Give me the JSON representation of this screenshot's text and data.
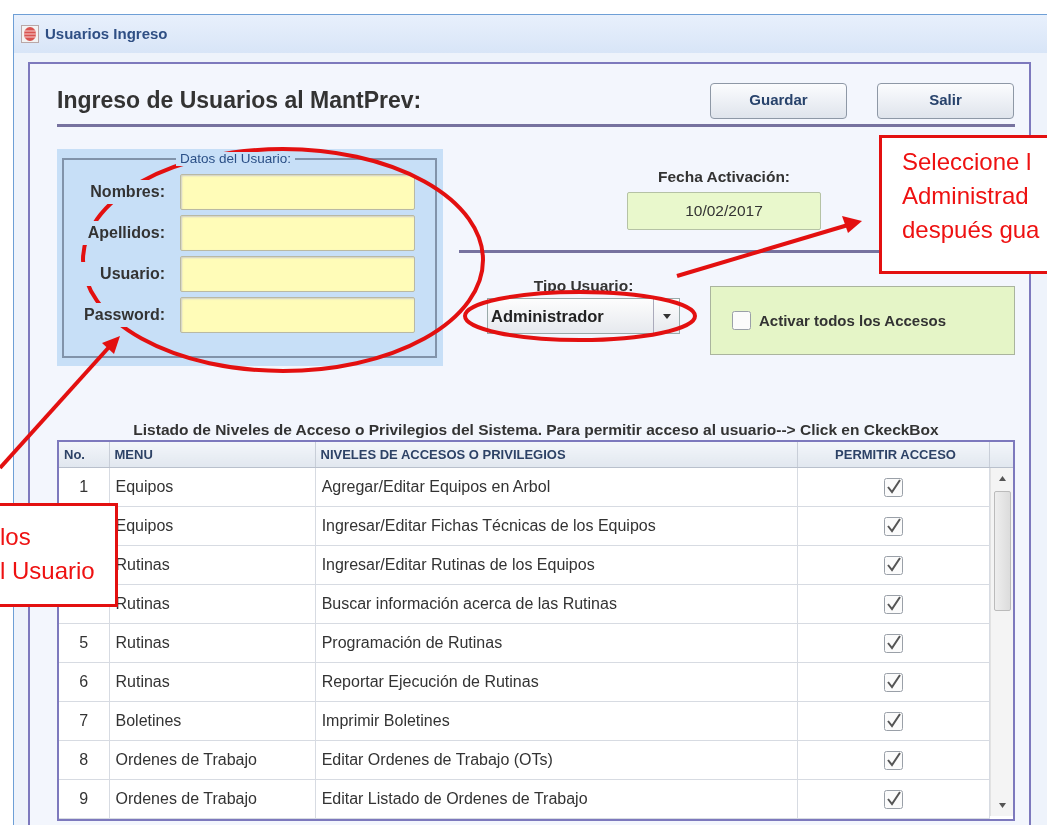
{
  "window": {
    "title": "Usuarios Ingreso"
  },
  "header": {
    "title": "Ingreso de Usuarios al MantPrev:",
    "buttons": [
      "Guardar",
      "Salir"
    ]
  },
  "user_group": {
    "legend": "Datos del Usuario:",
    "fields": [
      {
        "label": "Nombres:"
      },
      {
        "label": "Apellidos:"
      },
      {
        "label": "Usuario:"
      },
      {
        "label": "Password:"
      }
    ]
  },
  "activation": {
    "label": "Fecha Activación:",
    "value": "10/02/2017"
  },
  "user_type": {
    "label": "Tipo Usuario:",
    "value": "Administrador"
  },
  "activate_all": {
    "label": "Activar todos los Accesos",
    "checked": false
  },
  "table": {
    "caption": "Listado de Niveles de Acceso o Privilegios del Sistema. Para permitir acceso al usuario--> Click en CkeckBox",
    "columns": [
      "No.",
      "MENU",
      "NIVELES DE ACCESOS O PRIVILEGIOS",
      "PERMITIR ACCESO"
    ],
    "rows": [
      {
        "no": "1",
        "menu": "Equipos",
        "privilege": "Agregar/Editar Equipos en Arbol",
        "allowed": true
      },
      {
        "menu": "Equipos",
        "privilege": "Ingresar/Editar Fichas Técnicas de los Equipos",
        "allowed": true
      },
      {
        "menu": "Rutinas",
        "privilege": "Ingresar/Editar Rutinas de los Equipos",
        "allowed": true
      },
      {
        "menu": "Rutinas",
        "privilege": "Buscar información acerca de las Rutinas",
        "allowed": true
      },
      {
        "no": "5",
        "menu": "Rutinas",
        "privilege": "Programación de Rutinas",
        "allowed": true
      },
      {
        "no": "6",
        "menu": "Rutinas",
        "privilege": "Reportar Ejecución de Rutinas",
        "allowed": true
      },
      {
        "no": "7",
        "menu": "Boletines",
        "privilege": "Imprimir Boletines",
        "allowed": true
      },
      {
        "no": "8",
        "menu": "Ordenes de Trabajo",
        "privilege": "Editar Ordenes de Trabajo (OTs)",
        "allowed": true
      },
      {
        "no": "9",
        "menu": "Ordenes de Trabajo",
        "privilege": "Editar Listado de Ordenes de Trabajo",
        "allowed": true
      }
    ]
  },
  "annotations": [
    {
      "lines": [
        "Seleccione l",
        "Administrad",
        "después gua"
      ]
    },
    {
      "lines": [
        "los",
        "l Usuario"
      ]
    }
  ]
}
